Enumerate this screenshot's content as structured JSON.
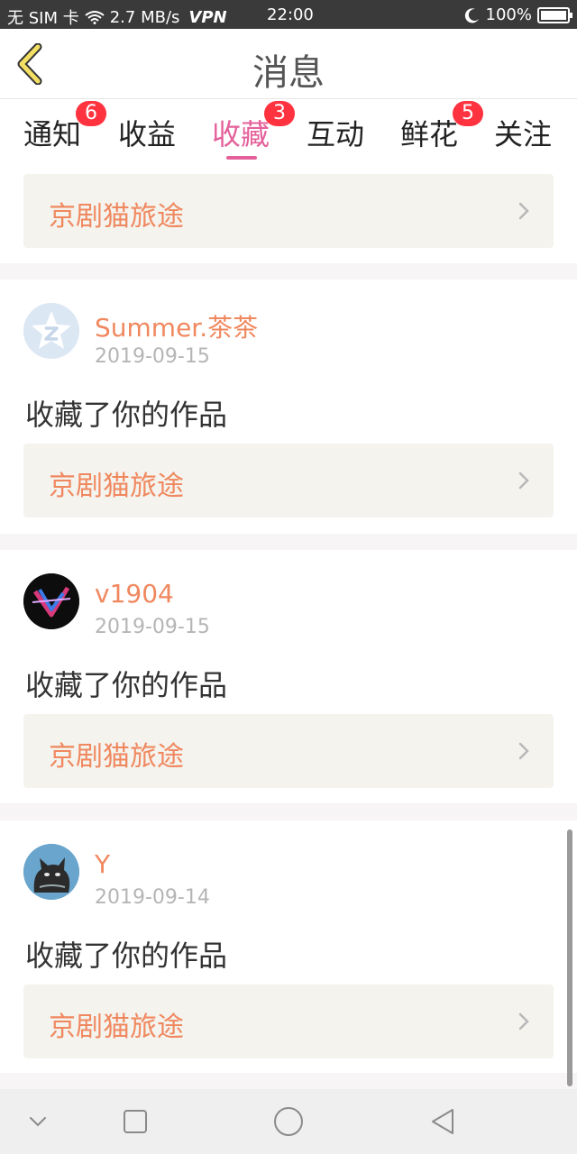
{
  "status_bar": {
    "carrier": "无 SIM 卡",
    "speed": "2.7 MB/s",
    "vpn": "VPN",
    "time": "22:00",
    "battery": "100%"
  },
  "header": {
    "title": "消息"
  },
  "tabs": [
    {
      "label": "通知",
      "badge": "6"
    },
    {
      "label": "收益",
      "badge": ""
    },
    {
      "label": "收藏",
      "badge": "3"
    },
    {
      "label": "互动",
      "badge": ""
    },
    {
      "label": "鲜花",
      "badge": "5"
    },
    {
      "label": "关注",
      "badge": ""
    }
  ],
  "active_tab": "收藏",
  "colors": {
    "accent": "#e4609b",
    "name": "#f0885f",
    "badge": "#ff3340"
  },
  "top_work": {
    "title": "京剧猫旅途"
  },
  "messages": [
    {
      "user": "Summer.茶茶",
      "date": "2019-09-15",
      "action": "收藏了你的作品",
      "work": "京剧猫旅途",
      "avatar": "default-star-avatar"
    },
    {
      "user": "v1904",
      "date": "2019-09-15",
      "action": "收藏了你的作品",
      "work": "京剧猫旅途",
      "avatar": "v-logo-avatar"
    },
    {
      "user": "Y",
      "date": "2019-09-14",
      "action": "收藏了你的作品",
      "work": "京剧猫旅途",
      "avatar": "cat-avatar"
    }
  ],
  "navbar": {
    "icons": [
      "chevron-down-icon",
      "square-icon",
      "circle-icon",
      "back-triangle-icon"
    ]
  }
}
